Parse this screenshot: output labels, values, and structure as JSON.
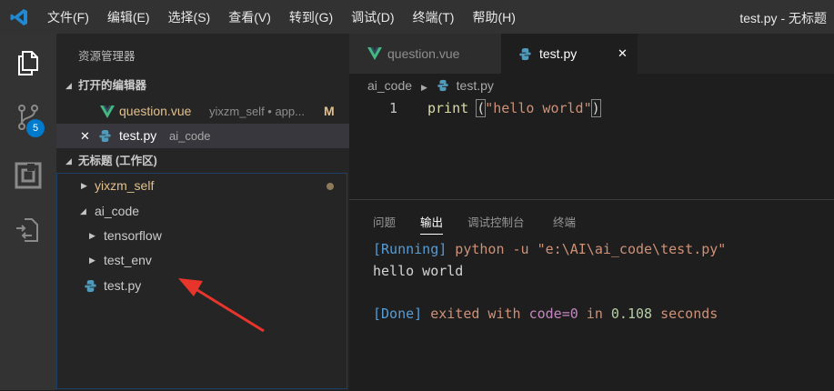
{
  "menu": [
    "文件(F)",
    "编辑(E)",
    "选择(S)",
    "查看(V)",
    "转到(G)",
    "调试(D)",
    "终端(T)",
    "帮助(H)"
  ],
  "window_title": "test.py - 无标题",
  "activity": {
    "badge": "5"
  },
  "sidebar": {
    "title": "资源管理器",
    "open_editors_header": "打开的编辑器",
    "open_editors": [
      {
        "name": "question.vue",
        "desc": "yixzm_self • app...",
        "status": "M"
      },
      {
        "name": "test.py",
        "desc": "ai_code"
      }
    ],
    "workspace_header": "无标题 (工作区)",
    "tree": [
      {
        "name": "yixzm_self"
      },
      {
        "name": "ai_code"
      },
      {
        "name": "tensorflow"
      },
      {
        "name": "test_env"
      },
      {
        "name": "test.py"
      }
    ]
  },
  "tabs": [
    {
      "name": "question.vue"
    },
    {
      "name": "test.py",
      "close": "✕"
    }
  ],
  "breadcrumb": {
    "folder": "ai_code",
    "file": "test.py"
  },
  "editor": {
    "line_number": "1",
    "code_print": "print",
    "code_open": "(",
    "code_string": "\"hello world\"",
    "code_close": ")"
  },
  "panel": {
    "tabs": [
      "问题",
      "输出",
      "调试控制台",
      "终端"
    ],
    "running_tag": "[Running]",
    "running_cmd": " python -u \"e:\\AI\\ai_code\\test.py\"",
    "output": "hello world",
    "done_tag": "[Done]",
    "done_exited": " exited with ",
    "done_code": "code=0",
    "done_in": " in ",
    "done_num": "0.108",
    "done_seconds": " seconds"
  },
  "colors": {
    "accent": "#007acc",
    "vue": "#42b883",
    "python": "#519aba",
    "modified": "#e2c08d",
    "folder_modified": "#e2c08d",
    "arrow": "#e8352b"
  }
}
